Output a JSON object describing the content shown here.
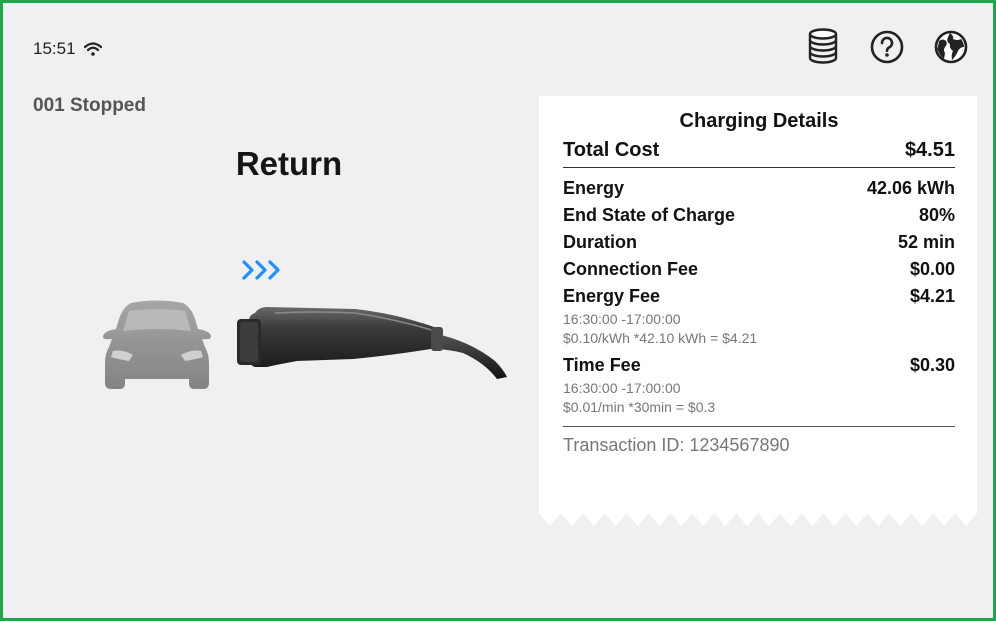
{
  "status_bar": {
    "time": "15:51",
    "wifi_icon": "wifi-icon"
  },
  "top_icons": [
    "coins-icon",
    "help-icon",
    "globe-icon"
  ],
  "station_status": "001 Stopped",
  "instruction": "Return",
  "colors": {
    "accent_blue": "#1e90ff",
    "frame_border": "#1aa84a",
    "background": "#f0f0f3"
  },
  "receipt": {
    "title": "Charging Details",
    "total_label": "Total Cost",
    "total_value": "$4.51",
    "items": [
      {
        "label": "Energy",
        "value": "42.06 kWh"
      },
      {
        "label": "End State of Charge",
        "value": "80%"
      },
      {
        "label": "Duration",
        "value": "52 min"
      },
      {
        "label": "Connection Fee",
        "value": "$0.00"
      }
    ],
    "energy_fee": {
      "label": "Energy Fee",
      "value": "$4.21",
      "period": "16:30:00 -17:00:00",
      "formula": "$0.10/kWh *42.10 kWh = $4.21"
    },
    "time_fee": {
      "label": "Time Fee",
      "value": "$0.30",
      "period": "16:30:00 -17:00:00",
      "formula": "$0.01/min *30min = $0.3"
    },
    "transaction": "Transaction ID: 1234567890"
  }
}
